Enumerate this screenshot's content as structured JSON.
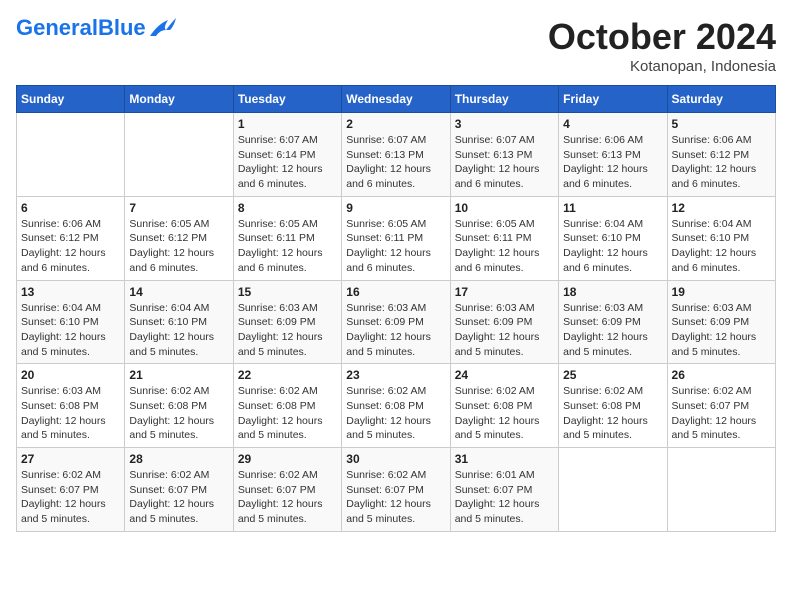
{
  "logo": {
    "text_general": "General",
    "text_blue": "Blue"
  },
  "title": {
    "month": "October 2024",
    "location": "Kotanopan, Indonesia"
  },
  "headers": [
    "Sunday",
    "Monday",
    "Tuesday",
    "Wednesday",
    "Thursday",
    "Friday",
    "Saturday"
  ],
  "weeks": [
    [
      {
        "day": "",
        "info": ""
      },
      {
        "day": "",
        "info": ""
      },
      {
        "day": "1",
        "info": "Sunrise: 6:07 AM\nSunset: 6:14 PM\nDaylight: 12 hours\nand 6 minutes."
      },
      {
        "day": "2",
        "info": "Sunrise: 6:07 AM\nSunset: 6:13 PM\nDaylight: 12 hours\nand 6 minutes."
      },
      {
        "day": "3",
        "info": "Sunrise: 6:07 AM\nSunset: 6:13 PM\nDaylight: 12 hours\nand 6 minutes."
      },
      {
        "day": "4",
        "info": "Sunrise: 6:06 AM\nSunset: 6:13 PM\nDaylight: 12 hours\nand 6 minutes."
      },
      {
        "day": "5",
        "info": "Sunrise: 6:06 AM\nSunset: 6:12 PM\nDaylight: 12 hours\nand 6 minutes."
      }
    ],
    [
      {
        "day": "6",
        "info": "Sunrise: 6:06 AM\nSunset: 6:12 PM\nDaylight: 12 hours\nand 6 minutes."
      },
      {
        "day": "7",
        "info": "Sunrise: 6:05 AM\nSunset: 6:12 PM\nDaylight: 12 hours\nand 6 minutes."
      },
      {
        "day": "8",
        "info": "Sunrise: 6:05 AM\nSunset: 6:11 PM\nDaylight: 12 hours\nand 6 minutes."
      },
      {
        "day": "9",
        "info": "Sunrise: 6:05 AM\nSunset: 6:11 PM\nDaylight: 12 hours\nand 6 minutes."
      },
      {
        "day": "10",
        "info": "Sunrise: 6:05 AM\nSunset: 6:11 PM\nDaylight: 12 hours\nand 6 minutes."
      },
      {
        "day": "11",
        "info": "Sunrise: 6:04 AM\nSunset: 6:10 PM\nDaylight: 12 hours\nand 6 minutes."
      },
      {
        "day": "12",
        "info": "Sunrise: 6:04 AM\nSunset: 6:10 PM\nDaylight: 12 hours\nand 6 minutes."
      }
    ],
    [
      {
        "day": "13",
        "info": "Sunrise: 6:04 AM\nSunset: 6:10 PM\nDaylight: 12 hours\nand 5 minutes."
      },
      {
        "day": "14",
        "info": "Sunrise: 6:04 AM\nSunset: 6:10 PM\nDaylight: 12 hours\nand 5 minutes."
      },
      {
        "day": "15",
        "info": "Sunrise: 6:03 AM\nSunset: 6:09 PM\nDaylight: 12 hours\nand 5 minutes."
      },
      {
        "day": "16",
        "info": "Sunrise: 6:03 AM\nSunset: 6:09 PM\nDaylight: 12 hours\nand 5 minutes."
      },
      {
        "day": "17",
        "info": "Sunrise: 6:03 AM\nSunset: 6:09 PM\nDaylight: 12 hours\nand 5 minutes."
      },
      {
        "day": "18",
        "info": "Sunrise: 6:03 AM\nSunset: 6:09 PM\nDaylight: 12 hours\nand 5 minutes."
      },
      {
        "day": "19",
        "info": "Sunrise: 6:03 AM\nSunset: 6:09 PM\nDaylight: 12 hours\nand 5 minutes."
      }
    ],
    [
      {
        "day": "20",
        "info": "Sunrise: 6:03 AM\nSunset: 6:08 PM\nDaylight: 12 hours\nand 5 minutes."
      },
      {
        "day": "21",
        "info": "Sunrise: 6:02 AM\nSunset: 6:08 PM\nDaylight: 12 hours\nand 5 minutes."
      },
      {
        "day": "22",
        "info": "Sunrise: 6:02 AM\nSunset: 6:08 PM\nDaylight: 12 hours\nand 5 minutes."
      },
      {
        "day": "23",
        "info": "Sunrise: 6:02 AM\nSunset: 6:08 PM\nDaylight: 12 hours\nand 5 minutes."
      },
      {
        "day": "24",
        "info": "Sunrise: 6:02 AM\nSunset: 6:08 PM\nDaylight: 12 hours\nand 5 minutes."
      },
      {
        "day": "25",
        "info": "Sunrise: 6:02 AM\nSunset: 6:08 PM\nDaylight: 12 hours\nand 5 minutes."
      },
      {
        "day": "26",
        "info": "Sunrise: 6:02 AM\nSunset: 6:07 PM\nDaylight: 12 hours\nand 5 minutes."
      }
    ],
    [
      {
        "day": "27",
        "info": "Sunrise: 6:02 AM\nSunset: 6:07 PM\nDaylight: 12 hours\nand 5 minutes."
      },
      {
        "day": "28",
        "info": "Sunrise: 6:02 AM\nSunset: 6:07 PM\nDaylight: 12 hours\nand 5 minutes."
      },
      {
        "day": "29",
        "info": "Sunrise: 6:02 AM\nSunset: 6:07 PM\nDaylight: 12 hours\nand 5 minutes."
      },
      {
        "day": "30",
        "info": "Sunrise: 6:02 AM\nSunset: 6:07 PM\nDaylight: 12 hours\nand 5 minutes."
      },
      {
        "day": "31",
        "info": "Sunrise: 6:01 AM\nSunset: 6:07 PM\nDaylight: 12 hours\nand 5 minutes."
      },
      {
        "day": "",
        "info": ""
      },
      {
        "day": "",
        "info": ""
      }
    ]
  ]
}
